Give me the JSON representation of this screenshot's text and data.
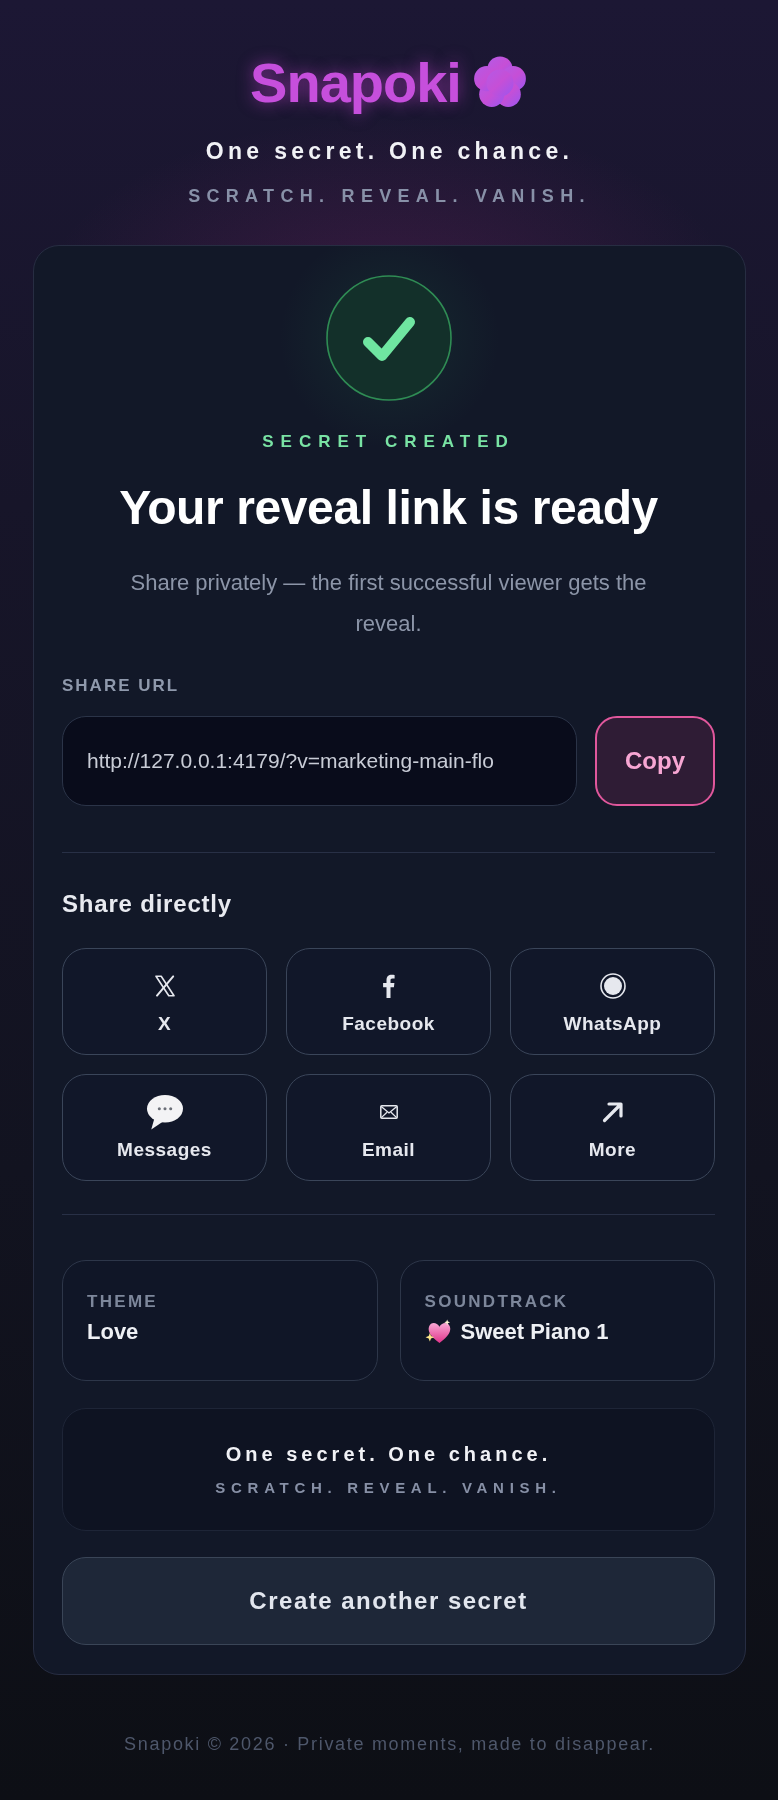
{
  "header": {
    "logo": "Snapoki",
    "tagline": "One secret. One chance.",
    "subtagline": "SCRATCH. REVEAL. VANISH."
  },
  "result": {
    "status": "SECRET CREATED",
    "title": "Your reveal link is ready",
    "description": "Share privately — the first successful viewer gets the reveal."
  },
  "share_url": {
    "label": "SHARE URL",
    "value": "http://127.0.0.1:4179/?v=marketing-main-flo",
    "copy_button": "Copy"
  },
  "share_directly": {
    "heading": "Share directly",
    "buttons": [
      {
        "kind": "x",
        "label": "X"
      },
      {
        "kind": "facebook",
        "label": "Facebook"
      },
      {
        "kind": "whatsapp",
        "label": "WhatsApp"
      },
      {
        "kind": "messages",
        "label": "Messages"
      },
      {
        "kind": "email",
        "label": "Email"
      },
      {
        "kind": "more",
        "label": "More"
      }
    ]
  },
  "theme": {
    "label": "THEME",
    "value": "Love"
  },
  "soundtrack": {
    "label": "SOUNDTRACK",
    "value": "Sweet Piano 1"
  },
  "motto": {
    "tagline": "One secret. One chance.",
    "subtagline": "SCRATCH. REVEAL. VANISH."
  },
  "create_button": "Create another secret",
  "footer": "Snapoki © 2026 · Private moments, made to disappear."
}
